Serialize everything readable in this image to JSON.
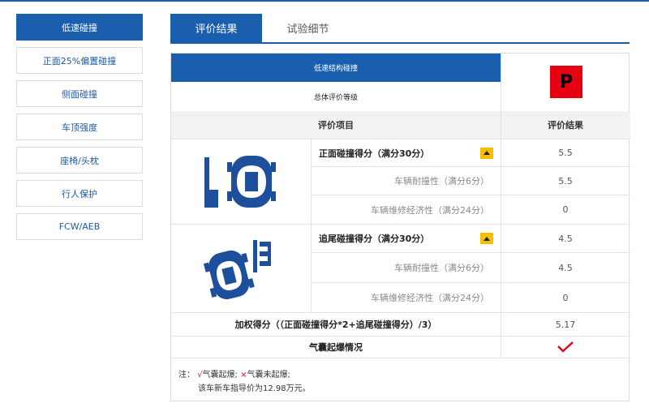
{
  "sidebar": {
    "items": [
      {
        "label": "低速碰撞"
      },
      {
        "label": "正面25%偏置碰撞"
      },
      {
        "label": "侧面碰撞"
      },
      {
        "label": "车顶强度"
      },
      {
        "label": "座椅/头枕"
      },
      {
        "label": "行人保护"
      },
      {
        "label": "FCW/AEB"
      }
    ],
    "active_index": 0
  },
  "tabs": {
    "result": "评价结果",
    "detail": "试验细节"
  },
  "panel": {
    "section_title": "低速结构碰撞",
    "overall_label": "总体评价等级",
    "overall_grade": "P",
    "grade_color": "#e60012",
    "header_item": "评价项目",
    "header_result": "评价结果",
    "front": {
      "title": "正面碰撞得分（满分30分）",
      "score": "5.5",
      "subs": [
        {
          "label": "车辆耐撞性（满分6分）",
          "value": "5.5"
        },
        {
          "label": "车辆维修经济性（满分24分）",
          "value": "0"
        }
      ]
    },
    "rear": {
      "title": "追尾碰撞得分（满分30分）",
      "score": "4.5",
      "subs": [
        {
          "label": "车辆耐撞性（满分6分）",
          "value": "4.5"
        },
        {
          "label": "车辆维修经济性（满分24分）",
          "value": "0"
        }
      ]
    },
    "weighted_label": "加权得分（（正面碰撞得分*2+追尾碰撞得分）/3）",
    "weighted_value": "5.17",
    "airbag_label": "气囊起爆情况",
    "note": {
      "prefix": "注：",
      "tick": "√",
      "deployed": "气囊起爆;",
      "cross": "×",
      "not_deployed": "气囊未起爆;",
      "price": "该车新车指导价为12.98万元。"
    }
  },
  "colors": {
    "primary": "#1a5fae",
    "accent": "#e60012",
    "warning": "#f6c000"
  }
}
